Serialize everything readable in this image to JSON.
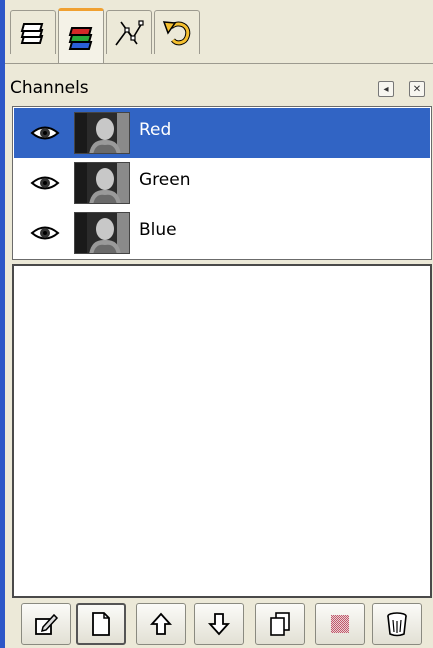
{
  "tabs": [
    {
      "icon": "layers-icon"
    },
    {
      "icon": "channels-icon",
      "active": true
    },
    {
      "icon": "paths-icon"
    },
    {
      "icon": "undo-history-icon"
    }
  ],
  "panel": {
    "title": "Channels",
    "header_buttons": [
      {
        "icon": "configure-menu-icon"
      },
      {
        "icon": "close-icon"
      }
    ]
  },
  "channels": [
    {
      "label": "Red",
      "selected": true,
      "visible": true
    },
    {
      "label": "Green",
      "selected": false,
      "visible": true
    },
    {
      "label": "Blue",
      "selected": false,
      "visible": true
    }
  ],
  "toolbar": [
    {
      "icon": "edit-channel-attributes-icon"
    },
    {
      "icon": "new-channel-icon"
    },
    {
      "icon": "raise-channel-icon"
    },
    {
      "icon": "lower-channel-icon"
    },
    {
      "icon": "duplicate-channel-icon"
    },
    {
      "icon": "channel-to-selection-icon",
      "disabled": true
    },
    {
      "icon": "delete-channel-icon"
    }
  ],
  "colors": {
    "selection": "#3164c4",
    "window_edge": "#2d57c8",
    "panel_bg": "#ece9d8",
    "active_tab_accent": "#f0a030"
  }
}
